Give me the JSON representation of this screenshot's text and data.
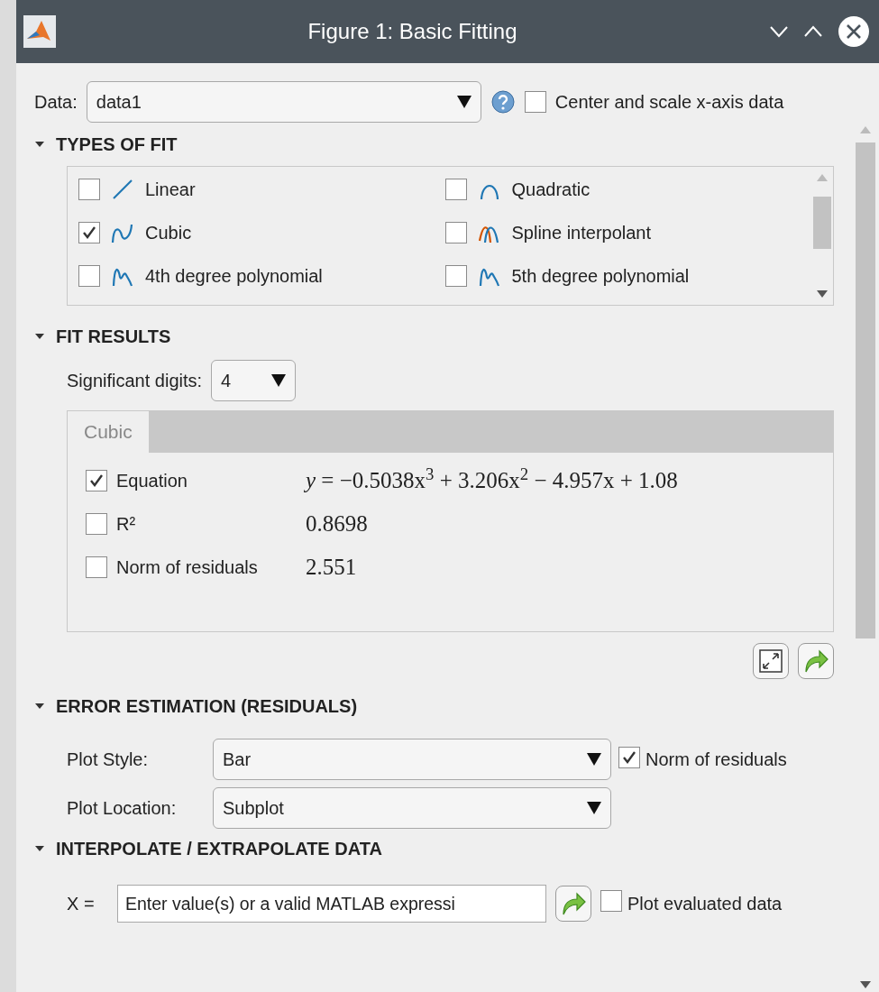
{
  "window": {
    "title": "Figure 1: Basic Fitting"
  },
  "data_row": {
    "label": "Data:",
    "value": "data1",
    "center_scale": {
      "label": "Center and scale x-axis data",
      "checked": false
    }
  },
  "types_of_fit": {
    "title": "TYPES OF FIT",
    "items": [
      {
        "label": "Linear",
        "kind": "linear",
        "checked": false
      },
      {
        "label": "Quadratic",
        "kind": "quadratic",
        "checked": false
      },
      {
        "label": "Cubic",
        "kind": "cubic",
        "checked": true
      },
      {
        "label": "Spline interpolant",
        "kind": "spline",
        "checked": false
      },
      {
        "label": "4th degree polynomial",
        "kind": "poly",
        "checked": false
      },
      {
        "label": "5th degree polynomial",
        "kind": "poly",
        "checked": false
      }
    ]
  },
  "fit_results": {
    "title": "FIT RESULTS",
    "digits_label": "Significant digits:",
    "digits_value": "4",
    "tabs": [
      {
        "label": "Cubic",
        "selected": true
      }
    ],
    "rows": [
      {
        "label": "Equation",
        "checked": true,
        "value": "*y* = −0.5038x$^{3}$ + 3.206x$^{2}$ − 4.957x + 1.08"
      },
      {
        "label": "R²",
        "checked": false,
        "value": "0.8698"
      },
      {
        "label": "Norm of residuals",
        "checked": false,
        "value": "2.551"
      }
    ]
  },
  "error_estimation": {
    "title": "ERROR ESTIMATION (RESIDUALS)",
    "plot_style_label": "Plot Style:",
    "plot_style": "Bar",
    "norm": {
      "label": "Norm of residuals",
      "checked": true
    },
    "plot_location_label": "Plot Location:",
    "plot_location": "Subplot"
  },
  "interpolate": {
    "title": "INTERPOLATE / EXTRAPOLATE DATA",
    "x_label": "X =",
    "placeholder": "Enter value(s) or a valid MATLAB expressi",
    "plot_evaluated": {
      "label": "Plot evaluated data",
      "checked": false
    }
  }
}
